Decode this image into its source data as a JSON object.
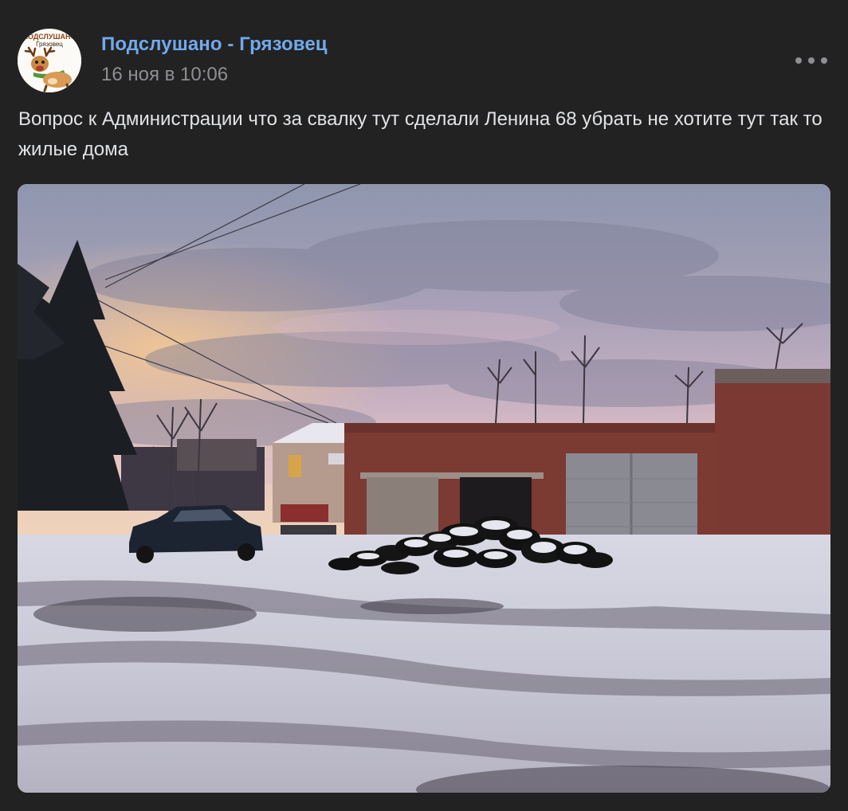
{
  "post": {
    "avatar": {
      "logo_text_top": "ПОДСЛУШАНО",
      "logo_text_bottom": "Грязовец"
    },
    "author": "Подслушано - Грязовец",
    "date": "16 ноя в 10:06",
    "text": "Вопрос к Администрации что за свалку тут сделали Ленина 68 убрать не хотите тут так то жилые дома",
    "menu_icon": "more-horizontal-icon"
  },
  "colors": {
    "background": "#222223",
    "author_link": "#71aaeb",
    "meta_gray": "#8f8f93",
    "body_text": "#e1e3e6"
  }
}
